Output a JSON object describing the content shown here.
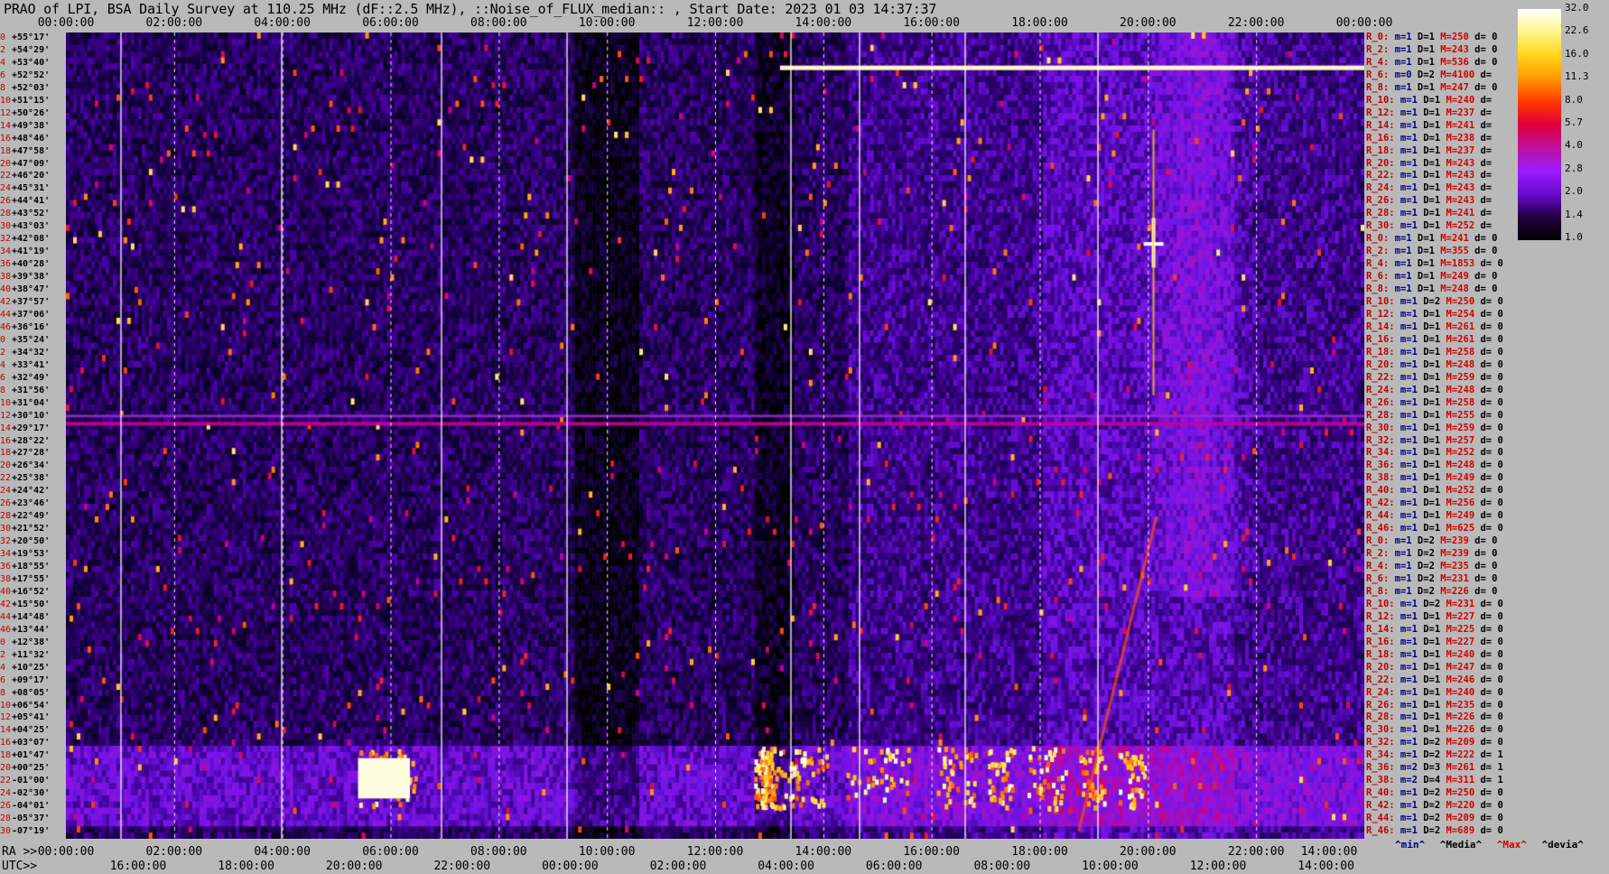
{
  "title": "PRAO of LPI, BSA Daily Survey at 110.25 MHz (dF::2.5 MHz), ::Noise_of_FLUX_median:: , Start Date: 2023 01 03 14:37:37",
  "top_ticks": [
    "00:00:00",
    "02:00:00",
    "04:00:00",
    "06:00:00",
    "08:00:00",
    "10:00:00",
    "12:00:00",
    "14:00:00",
    "16:00:00",
    "18:00:00",
    "20:00:00",
    "22:00:00",
    "00:00:00"
  ],
  "ra_label": "RA >>",
  "ra_ticks": [
    "00:00:00",
    "02:00:00",
    "04:00:00",
    "06:00:00",
    "08:00:00",
    "10:00:00",
    "12:00:00",
    "14:00:00",
    "16:00:00",
    "18:00:00",
    "20:00:00",
    "22:00:00",
    "14:00:00"
  ],
  "utc_label": "UTC>>",
  "utc_ticks": [
    "16:00:00",
    "18:00:00",
    "20:00:00",
    "22:00:00",
    "00:00:00",
    "02:00:00",
    "04:00:00",
    "06:00:00",
    "08:00:00",
    "10:00:00",
    "12:00:00",
    "14:00:00"
  ],
  "colorbar": {
    "labels": [
      "32.0",
      "22.6",
      "16.0",
      "11.3",
      "8.0",
      "5.7",
      "4.0",
      "2.8",
      "2.0",
      "1.4",
      "1.0"
    ],
    "stops": [
      "#ffffff",
      "#fff68a",
      "#ffd51a",
      "#ff9a00",
      "#ff3a00",
      "#e0003c",
      "#c0109c",
      "#9a1cff",
      "#6a0ad0",
      "#22003e",
      "#000000"
    ]
  },
  "legend": {
    "min": "^min^",
    "median": "^Media^",
    "max": "^Max^",
    "devia": "^devia^"
  },
  "decl_rows": [
    {
      "i": "0",
      "d": "+55°17'"
    },
    {
      "i": "2",
      "d": "+54°29'"
    },
    {
      "i": "4",
      "d": "+53°40'"
    },
    {
      "i": "6",
      "d": "+52°52'"
    },
    {
      "i": "8",
      "d": "+52°03'"
    },
    {
      "i": "10",
      "d": "+51°15'"
    },
    {
      "i": "12",
      "d": "+50°26'"
    },
    {
      "i": "14",
      "d": "+49°38'"
    },
    {
      "i": "16",
      "d": "+48°46'"
    },
    {
      "i": "18",
      "d": "+47°58'"
    },
    {
      "i": "20",
      "d": "+47°09'"
    },
    {
      "i": "22",
      "d": "+46°20'"
    },
    {
      "i": "24",
      "d": "+45°31'"
    },
    {
      "i": "26",
      "d": "+44°41'"
    },
    {
      "i": "28",
      "d": "+43°52'"
    },
    {
      "i": "30",
      "d": "+43°03'"
    },
    {
      "i": "32",
      "d": "+42°08'"
    },
    {
      "i": "34",
      "d": "+41°19'"
    },
    {
      "i": "36",
      "d": "+40°28'"
    },
    {
      "i": "38",
      "d": "+39°38'"
    },
    {
      "i": "40",
      "d": "+38°47'"
    },
    {
      "i": "42",
      "d": "+37°57'"
    },
    {
      "i": "44",
      "d": "+37°06'"
    },
    {
      "i": "46",
      "d": "+36°16'"
    },
    {
      "i": "0",
      "d": "+35°24'"
    },
    {
      "i": "2",
      "d": "+34°32'"
    },
    {
      "i": "4",
      "d": "+33°41'"
    },
    {
      "i": "6",
      "d": "+32°49'"
    },
    {
      "i": "8",
      "d": "+31°56'"
    },
    {
      "i": "10",
      "d": "+31°04'"
    },
    {
      "i": "12",
      "d": "+30°10'"
    },
    {
      "i": "14",
      "d": "+29°17'"
    },
    {
      "i": "16",
      "d": "+28°22'"
    },
    {
      "i": "18",
      "d": "+27°28'"
    },
    {
      "i": "20",
      "d": "+26°34'"
    },
    {
      "i": "22",
      "d": "+25°38'"
    },
    {
      "i": "24",
      "d": "+24°42'"
    },
    {
      "i": "26",
      "d": "+23°46'"
    },
    {
      "i": "28",
      "d": "+22°49'"
    },
    {
      "i": "30",
      "d": "+21°52'"
    },
    {
      "i": "32",
      "d": "+20°50'"
    },
    {
      "i": "34",
      "d": "+19°53'"
    },
    {
      "i": "36",
      "d": "+18°55'"
    },
    {
      "i": "38",
      "d": "+17°55'"
    },
    {
      "i": "40",
      "d": "+16°52'"
    },
    {
      "i": "42",
      "d": "+15°50'"
    },
    {
      "i": "44",
      "d": "+14°48'"
    },
    {
      "i": "46",
      "d": "+13°44'"
    },
    {
      "i": "0",
      "d": "+12°38'"
    },
    {
      "i": "2",
      "d": "+11°32'"
    },
    {
      "i": "4",
      "d": "+10°25'"
    },
    {
      "i": "6",
      "d": "+09°17'"
    },
    {
      "i": "8",
      "d": "+08°05'"
    },
    {
      "i": "10",
      "d": "+06°54'"
    },
    {
      "i": "12",
      "d": "+05°41'"
    },
    {
      "i": "14",
      "d": "+04°25'"
    },
    {
      "i": "16",
      "d": "+03°07'"
    },
    {
      "i": "18",
      "d": "+01°47'"
    },
    {
      "i": "20",
      "d": "+00°25'"
    },
    {
      "i": "22",
      "d": "-01°00'"
    },
    {
      "i": "24",
      "d": "-02°30'"
    },
    {
      "i": "26",
      "d": "-04°01'"
    },
    {
      "i": "28",
      "d": "-05°37'"
    },
    {
      "i": "30",
      "d": "-07°19'"
    }
  ],
  "r_rows": [
    {
      "r": "R_0:",
      "m": "1",
      "D": "1",
      "M": "250",
      "d": "0"
    },
    {
      "r": "R_2:",
      "m": "1",
      "D": "1",
      "M": "243",
      "d": "0"
    },
    {
      "r": "R_4:",
      "m": "1",
      "D": "1",
      "M": "536",
      "d": "0"
    },
    {
      "r": "R_6:",
      "m": "0",
      "D": "2",
      "M": "4100",
      "d": ""
    },
    {
      "r": "R_8:",
      "m": "1",
      "D": "1",
      "M": "247",
      "d": "0"
    },
    {
      "r": "R_10:",
      "m": "1",
      "D": "1",
      "M": "240",
      "d": ""
    },
    {
      "r": "R_12:",
      "m": "1",
      "D": "1",
      "M": "237",
      "d": ""
    },
    {
      "r": "R_14:",
      "m": "1",
      "D": "1",
      "M": "241",
      "d": ""
    },
    {
      "r": "R_16:",
      "m": "1",
      "D": "1",
      "M": "238",
      "d": ""
    },
    {
      "r": "R_18:",
      "m": "1",
      "D": "1",
      "M": "237",
      "d": ""
    },
    {
      "r": "R_20:",
      "m": "1",
      "D": "1",
      "M": "243",
      "d": ""
    },
    {
      "r": "R_22:",
      "m": "1",
      "D": "1",
      "M": "243",
      "d": ""
    },
    {
      "r": "R_24:",
      "m": "1",
      "D": "1",
      "M": "243",
      "d": ""
    },
    {
      "r": "R_26:",
      "m": "1",
      "D": "1",
      "M": "243",
      "d": ""
    },
    {
      "r": "R_28:",
      "m": "1",
      "D": "1",
      "M": "241",
      "d": ""
    },
    {
      "r": "R_30:",
      "m": "1",
      "D": "1",
      "M": "252",
      "d": ""
    },
    {
      "r": "R_0:",
      "m": "1",
      "D": "1",
      "M": "241",
      "d": "0"
    },
    {
      "r": "R_2:",
      "m": "1",
      "D": "1",
      "M": "355",
      "d": "0"
    },
    {
      "r": "R_4:",
      "m": "1",
      "D": "1",
      "M": "1853",
      "d": "0"
    },
    {
      "r": "R_6:",
      "m": "1",
      "D": "1",
      "M": "249",
      "d": "0"
    },
    {
      "r": "R_8:",
      "m": "1",
      "D": "1",
      "M": "248",
      "d": "0"
    },
    {
      "r": "R_10:",
      "m": "1",
      "D": "2",
      "M": "250",
      "d": "0"
    },
    {
      "r": "R_12:",
      "m": "1",
      "D": "1",
      "M": "254",
      "d": "0"
    },
    {
      "r": "R_14:",
      "m": "1",
      "D": "1",
      "M": "261",
      "d": "0"
    },
    {
      "r": "R_16:",
      "m": "1",
      "D": "1",
      "M": "261",
      "d": "0"
    },
    {
      "r": "R_18:",
      "m": "1",
      "D": "1",
      "M": "258",
      "d": "0"
    },
    {
      "r": "R_20:",
      "m": "1",
      "D": "1",
      "M": "248",
      "d": "0"
    },
    {
      "r": "R_22:",
      "m": "1",
      "D": "1",
      "M": "259",
      "d": "0"
    },
    {
      "r": "R_24:",
      "m": "1",
      "D": "1",
      "M": "248",
      "d": "0"
    },
    {
      "r": "R_26:",
      "m": "1",
      "D": "1",
      "M": "258",
      "d": "0"
    },
    {
      "r": "R_28:",
      "m": "1",
      "D": "1",
      "M": "255",
      "d": "0"
    },
    {
      "r": "R_30:",
      "m": "1",
      "D": "1",
      "M": "259",
      "d": "0"
    },
    {
      "r": "R_32:",
      "m": "1",
      "D": "1",
      "M": "257",
      "d": "0"
    },
    {
      "r": "R_34:",
      "m": "1",
      "D": "1",
      "M": "252",
      "d": "0"
    },
    {
      "r": "R_36:",
      "m": "1",
      "D": "1",
      "M": "248",
      "d": "0"
    },
    {
      "r": "R_38:",
      "m": "1",
      "D": "1",
      "M": "249",
      "d": "0"
    },
    {
      "r": "R_40:",
      "m": "1",
      "D": "1",
      "M": "252",
      "d": "0"
    },
    {
      "r": "R_42:",
      "m": "1",
      "D": "1",
      "M": "256",
      "d": "0"
    },
    {
      "r": "R_44:",
      "m": "1",
      "D": "1",
      "M": "249",
      "d": "0"
    },
    {
      "r": "R_46:",
      "m": "1",
      "D": "1",
      "M": "625",
      "d": "0"
    },
    {
      "r": "R_0:",
      "m": "1",
      "D": "2",
      "M": "239",
      "d": "0"
    },
    {
      "r": "R_2:",
      "m": "1",
      "D": "2",
      "M": "239",
      "d": "0"
    },
    {
      "r": "R_4:",
      "m": "1",
      "D": "2",
      "M": "235",
      "d": "0"
    },
    {
      "r": "R_6:",
      "m": "1",
      "D": "2",
      "M": "231",
      "d": "0"
    },
    {
      "r": "R_8:",
      "m": "1",
      "D": "2",
      "M": "226",
      "d": "0"
    },
    {
      "r": "R_10:",
      "m": "1",
      "D": "2",
      "M": "231",
      "d": "0"
    },
    {
      "r": "R_12:",
      "m": "1",
      "D": "1",
      "M": "227",
      "d": "0"
    },
    {
      "r": "R_14:",
      "m": "1",
      "D": "1",
      "M": "225",
      "d": "0"
    },
    {
      "r": "R_16:",
      "m": "1",
      "D": "1",
      "M": "227",
      "d": "0"
    },
    {
      "r": "R_18:",
      "m": "1",
      "D": "1",
      "M": "240",
      "d": "0"
    },
    {
      "r": "R_20:",
      "m": "1",
      "D": "1",
      "M": "247",
      "d": "0"
    },
    {
      "r": "R_22:",
      "m": "1",
      "D": "1",
      "M": "246",
      "d": "0"
    },
    {
      "r": "R_24:",
      "m": "1",
      "D": "1",
      "M": "240",
      "d": "0"
    },
    {
      "r": "R_26:",
      "m": "1",
      "D": "1",
      "M": "235",
      "d": "0"
    },
    {
      "r": "R_28:",
      "m": "1",
      "D": "1",
      "M": "226",
      "d": "0"
    },
    {
      "r": "R_30:",
      "m": "1",
      "D": "1",
      "M": "226",
      "d": "0"
    },
    {
      "r": "R_32:",
      "m": "1",
      "D": "2",
      "M": "209",
      "d": "0"
    },
    {
      "r": "R_34:",
      "m": "1",
      "D": "2",
      "M": "222",
      "d": "1"
    },
    {
      "r": "R_36:",
      "m": "2",
      "D": "3",
      "M": "261",
      "d": "1"
    },
    {
      "r": "R_38:",
      "m": "2",
      "D": "4",
      "M": "311",
      "d": "1"
    },
    {
      "r": "R_40:",
      "m": "1",
      "D": "2",
      "M": "250",
      "d": "0"
    },
    {
      "r": "R_42:",
      "m": "1",
      "D": "2",
      "M": "220",
      "d": "0"
    },
    {
      "r": "R_44:",
      "m": "1",
      "D": "2",
      "M": "209",
      "d": "0"
    },
    {
      "r": "R_46:",
      "m": "1",
      "D": "2",
      "M": "689",
      "d": "0"
    }
  ],
  "chart_data": {
    "type": "heatmap",
    "title": "PRAO of LPI, BSA Daily Survey at 110.25 MHz (dF::2.5 MHz), ::Noise_of_FLUX_median:: , Start Date: 2023 01 03 14:37:37",
    "xlabel": "RA / UTC",
    "ylabel": "",
    "x_ticks_ra": [
      "00:00:00",
      "02:00:00",
      "04:00:00",
      "06:00:00",
      "08:00:00",
      "10:00:00",
      "12:00:00",
      "14:00:00",
      "16:00:00",
      "18:00:00",
      "20:00:00",
      "22:00:00",
      "00:00:00"
    ],
    "color_scale": [
      1.0,
      1.4,
      2.0,
      2.8,
      4.0,
      5.7,
      8.0,
      11.3,
      16.0,
      22.6,
      32.0
    ],
    "features": [
      {
        "kind": "horizontal-band",
        "beam": "R_6",
        "ra_from": "13:40",
        "ra_to": "24:00",
        "level": 32.0
      },
      {
        "kind": "horizontal-band",
        "beam": "R_36-R_38",
        "ra_from": "00:00",
        "ra_to": "24:00",
        "level": 8.0
      },
      {
        "kind": "horizontal-band",
        "beam": "R_36-R_38 (lowest block)",
        "ra_from": "13:30",
        "ra_to": "24:00",
        "level": 22.6
      },
      {
        "kind": "point-source",
        "beam": "R_4",
        "ra": "20:00",
        "level": 32.0
      },
      {
        "kind": "point-source",
        "beam": "R_36-R_38 (lowest block)",
        "ra": "06:00",
        "level": 32.0
      },
      {
        "kind": "vertical-streak",
        "ra": "19:30",
        "level": 11.3
      }
    ]
  }
}
